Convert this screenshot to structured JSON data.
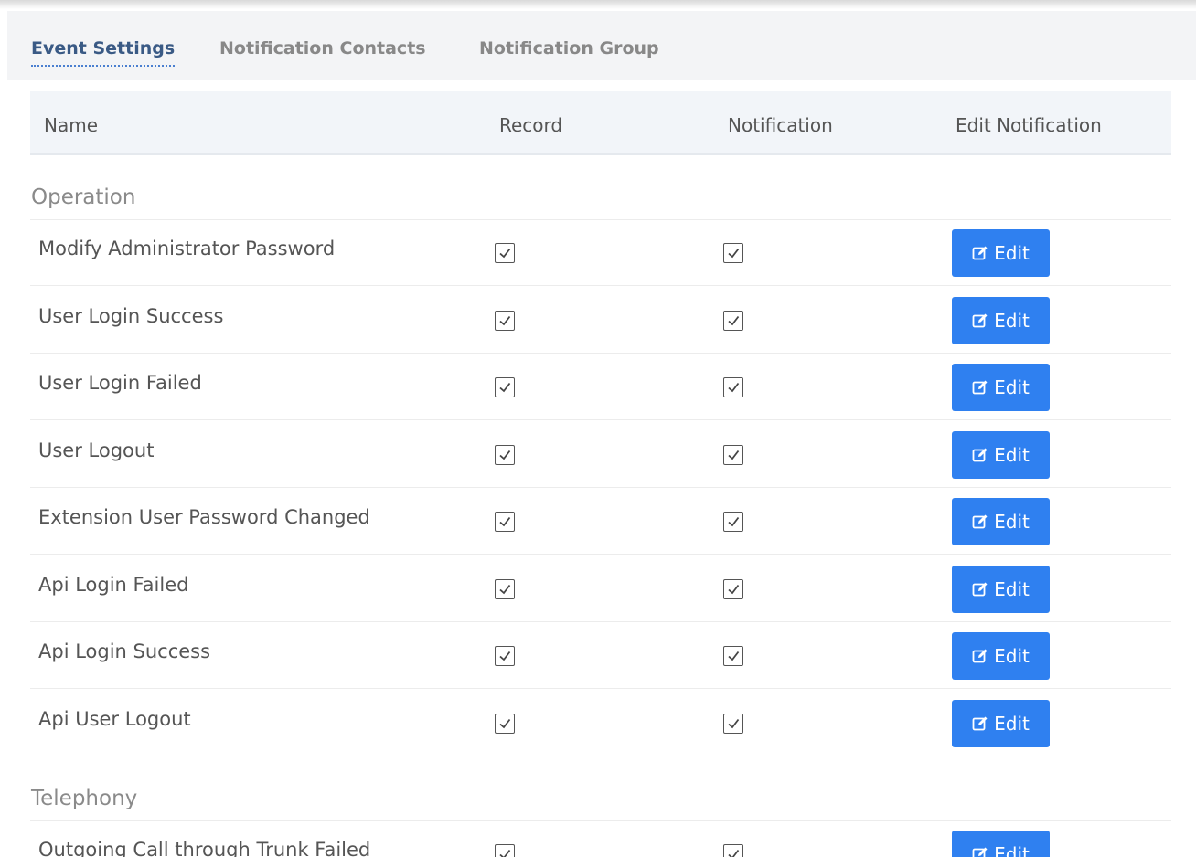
{
  "tabs": [
    {
      "label": "Event Settings",
      "active": true
    },
    {
      "label": "Notification Contacts",
      "active": false
    },
    {
      "label": "Notification Group",
      "active": false
    }
  ],
  "table": {
    "headers": {
      "name": "Name",
      "record": "Record",
      "notification": "Notification",
      "edit": "Edit Notification"
    },
    "edit_label": "Edit",
    "edit_icon": "edit-icon",
    "accent_color": "#2f80f0",
    "sections": [
      {
        "title": "Operation",
        "rows": [
          {
            "name": "Modify Administrator Password",
            "record": true,
            "notification": true
          },
          {
            "name": "User Login Success",
            "record": true,
            "notification": true
          },
          {
            "name": "User Login Failed",
            "record": true,
            "notification": true
          },
          {
            "name": "User Logout",
            "record": true,
            "notification": true
          },
          {
            "name": "Extension User Password Changed",
            "record": true,
            "notification": true
          },
          {
            "name": "Api Login Failed",
            "record": true,
            "notification": true
          },
          {
            "name": "Api Login Success",
            "record": true,
            "notification": true
          },
          {
            "name": "Api User Logout",
            "record": true,
            "notification": true
          }
        ]
      },
      {
        "title": "Telephony",
        "rows": [
          {
            "name": "Outgoing Call through Trunk Failed",
            "record": true,
            "notification": true
          }
        ]
      }
    ]
  }
}
